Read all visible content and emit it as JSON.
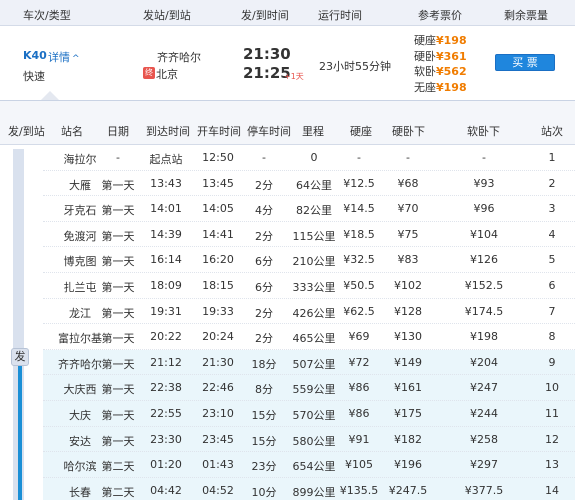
{
  "header": {
    "train_type": "车次/类型",
    "stations": "发站/到站",
    "times": "发/到时间",
    "duration": "运行时间",
    "fares": "参考票价",
    "remaining": "剩余票量"
  },
  "summary": {
    "train_no": "K40",
    "detail": "详情",
    "type": "快速",
    "from_station": "齐齐哈尔",
    "to_badge": "终",
    "to_station": "北京",
    "dep_time": "21:30",
    "arr_time": "21:25",
    "plus_day": "+1天",
    "duration": "23小时55分钟",
    "fares": [
      {
        "label": "硬座",
        "price": "¥198"
      },
      {
        "label": "硬卧",
        "price": "¥361"
      },
      {
        "label": "软卧",
        "price": "¥562"
      },
      {
        "label": "无座",
        "price": "¥198"
      }
    ],
    "buy_label": "买 票"
  },
  "stops_header": {
    "dep_arr": "发/到站",
    "station": "站名",
    "date": "日期",
    "arr_time": "到达时间",
    "dep_time": "开车时间",
    "stop_time": "停车时间",
    "distance": "里程",
    "hard_seat": "硬座",
    "hard_sleeper_low": "硬卧下",
    "soft_sleeper_low": "软卧下",
    "seq": "站次"
  },
  "dep_badge": "发",
  "stops": [
    {
      "name": "海拉尔",
      "date": "-",
      "arr": "起点站",
      "dep": "12:50",
      "stop": "-",
      "dist": "0",
      "hard": "-",
      "hsl": "-",
      "ssl": "-",
      "seq": "1"
    },
    {
      "name": "大雁",
      "date": "第一天",
      "arr": "13:43",
      "dep": "13:45",
      "stop": "2分",
      "dist": "64公里",
      "hard": "¥12.5",
      "hsl": "¥68",
      "ssl": "¥93",
      "seq": "2"
    },
    {
      "name": "牙克石",
      "date": "第一天",
      "arr": "14:01",
      "dep": "14:05",
      "stop": "4分",
      "dist": "82公里",
      "hard": "¥14.5",
      "hsl": "¥70",
      "ssl": "¥96",
      "seq": "3"
    },
    {
      "name": "免渡河",
      "date": "第一天",
      "arr": "14:39",
      "dep": "14:41",
      "stop": "2分",
      "dist": "115公里",
      "hard": "¥18.5",
      "hsl": "¥75",
      "ssl": "¥104",
      "seq": "4"
    },
    {
      "name": "博克图",
      "date": "第一天",
      "arr": "16:14",
      "dep": "16:20",
      "stop": "6分",
      "dist": "210公里",
      "hard": "¥32.5",
      "hsl": "¥83",
      "ssl": "¥126",
      "seq": "5"
    },
    {
      "name": "扎兰屯",
      "date": "第一天",
      "arr": "18:09",
      "dep": "18:15",
      "stop": "6分",
      "dist": "333公里",
      "hard": "¥50.5",
      "hsl": "¥102",
      "ssl": "¥152.5",
      "seq": "6"
    },
    {
      "name": "龙江",
      "date": "第一天",
      "arr": "19:31",
      "dep": "19:33",
      "stop": "2分",
      "dist": "426公里",
      "hard": "¥62.5",
      "hsl": "¥128",
      "ssl": "¥174.5",
      "seq": "7"
    },
    {
      "name": "富拉尔基",
      "date": "第一天",
      "arr": "20:22",
      "dep": "20:24",
      "stop": "2分",
      "dist": "465公里",
      "hard": "¥69",
      "hsl": "¥130",
      "ssl": "¥198",
      "seq": "8"
    },
    {
      "name": "齐齐哈尔",
      "date": "第一天",
      "arr": "21:12",
      "dep": "21:30",
      "stop": "18分",
      "dist": "507公里",
      "hard": "¥72",
      "hsl": "¥149",
      "ssl": "¥204",
      "seq": "9"
    },
    {
      "name": "大庆西",
      "date": "第一天",
      "arr": "22:38",
      "dep": "22:46",
      "stop": "8分",
      "dist": "559公里",
      "hard": "¥86",
      "hsl": "¥161",
      "ssl": "¥247",
      "seq": "10"
    },
    {
      "name": "大庆",
      "date": "第一天",
      "arr": "22:55",
      "dep": "23:10",
      "stop": "15分",
      "dist": "570公里",
      "hard": "¥86",
      "hsl": "¥175",
      "ssl": "¥244",
      "seq": "11"
    },
    {
      "name": "安达",
      "date": "第一天",
      "arr": "23:30",
      "dep": "23:45",
      "stop": "15分",
      "dist": "580公里",
      "hard": "¥91",
      "hsl": "¥182",
      "ssl": "¥258",
      "seq": "12"
    },
    {
      "name": "哈尔滨",
      "date": "第二天",
      "arr": "01:20",
      "dep": "01:43",
      "stop": "23分",
      "dist": "654公里",
      "hard": "¥105",
      "hsl": "¥196",
      "ssl": "¥297",
      "seq": "13"
    },
    {
      "name": "长春",
      "date": "第二天",
      "arr": "04:42",
      "dep": "04:52",
      "stop": "10分",
      "dist": "899公里",
      "hard": "¥135.5",
      "hsl": "¥247.5",
      "ssl": "¥377.5",
      "seq": "14"
    }
  ]
}
